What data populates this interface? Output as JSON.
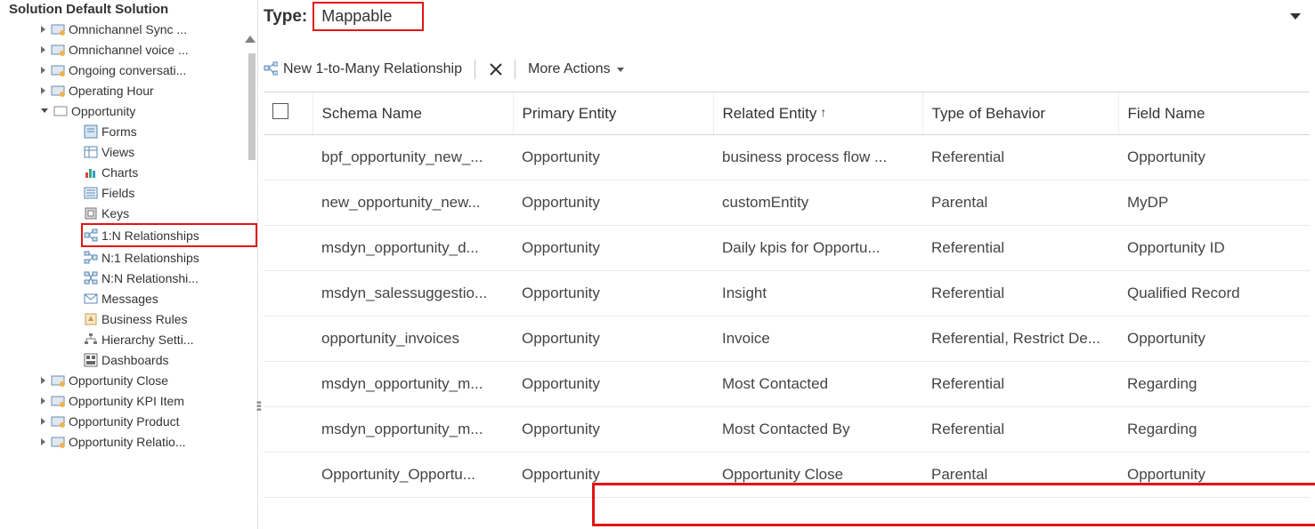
{
  "sidebar": {
    "title": "Solution Default Solution",
    "nodes_top": [
      {
        "label": "Omnichannel Sync ..."
      },
      {
        "label": "Omnichannel voice ..."
      },
      {
        "label": "Ongoing conversati..."
      },
      {
        "label": "Operating Hour"
      }
    ],
    "opportunity": {
      "label": "Opportunity",
      "children": [
        "Forms",
        "Views",
        "Charts",
        "Fields",
        "Keys",
        "1:N Relationships",
        "N:1 Relationships",
        "N:N Relationshi...",
        "Messages",
        "Business Rules",
        "Hierarchy Setti...",
        "Dashboards"
      ]
    },
    "nodes_bottom": [
      "Opportunity Close",
      "Opportunity KPI Item",
      "Opportunity Product",
      "Opportunity Relatio..."
    ]
  },
  "type": {
    "label": "Type:",
    "value": "Mappable"
  },
  "toolbar": {
    "new": "New 1-to-Many Relationship",
    "more": "More Actions"
  },
  "table": {
    "headers": {
      "schema": "Schema Name",
      "primary": "Primary Entity",
      "related": "Related Entity",
      "behavior": "Type of Behavior",
      "field": "Field Name"
    },
    "rows": [
      {
        "schema": "bpf_opportunity_new_...",
        "primary": "Opportunity",
        "related": "business process flow ...",
        "behavior": "Referential",
        "field": "Opportunity"
      },
      {
        "schema": "new_opportunity_new...",
        "primary": "Opportunity",
        "related": "customEntity",
        "behavior": "Parental",
        "field": "MyDP"
      },
      {
        "schema": "msdyn_opportunity_d...",
        "primary": "Opportunity",
        "related": "Daily kpis for Opportu...",
        "behavior": "Referential",
        "field": "Opportunity ID"
      },
      {
        "schema": "msdyn_salessuggestio...",
        "primary": "Opportunity",
        "related": "Insight",
        "behavior": "Referential",
        "field": "Qualified Record"
      },
      {
        "schema": "opportunity_invoices",
        "primary": "Opportunity",
        "related": "Invoice",
        "behavior": "Referential, Restrict De...",
        "field": "Opportunity"
      },
      {
        "schema": "msdyn_opportunity_m...",
        "primary": "Opportunity",
        "related": "Most Contacted",
        "behavior": "Referential",
        "field": "Regarding"
      },
      {
        "schema": "msdyn_opportunity_m...",
        "primary": "Opportunity",
        "related": "Most Contacted By",
        "behavior": "Referential",
        "field": "Regarding"
      },
      {
        "schema": "Opportunity_Opportu...",
        "primary": "Opportunity",
        "related": "Opportunity Close",
        "behavior": "Parental",
        "field": "Opportunity"
      }
    ]
  }
}
